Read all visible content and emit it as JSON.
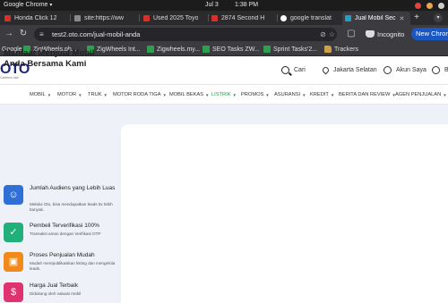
{
  "os_bar": {
    "app_name": "Google Chrome",
    "date": "Jul 3",
    "time": "1:38 PM"
  },
  "tabs": [
    {
      "label": "Honda Click 12",
      "favicon_color": "#d93025",
      "active": false
    },
    {
      "label": "site:https://ww",
      "favicon_color": "#8a8a8a",
      "active": false
    },
    {
      "label": "Used 2025 Toyo",
      "favicon_color": "#d93025",
      "active": false
    },
    {
      "label": "2874 Second H",
      "favicon_color": "#d93025",
      "active": false
    },
    {
      "label": "google translat",
      "favicon_color": "#ffffff",
      "active": false
    },
    {
      "label": "Jual Mobil Sec",
      "favicon_color": "#1fa0c9",
      "active": true
    }
  ],
  "toolbar": {
    "url": "test2.oto.com/jual-mobil-anda",
    "incognito_label": "Incognito",
    "new_chrome_label": "New Chrom"
  },
  "bookmarks": [
    {
      "label": "Google",
      "icon": "google-icon"
    },
    {
      "label": "ZigWheels.ph...",
      "icon": "green-square-icon"
    },
    {
      "label": "ZigWheels Int...",
      "icon": "green-square-icon"
    },
    {
      "label": "Zigwheels.my...",
      "icon": "green-square-icon"
    },
    {
      "label": "SEO Tasks ZW...",
      "icon": "green-square-icon"
    },
    {
      "label": "Sprint Tasks'2...",
      "icon": "green-square-icon"
    },
    {
      "label": "Trackers",
      "icon": "folder-icon"
    }
  ],
  "site_header": {
    "logo": "OTO",
    "logo_tagline": "Carilemu kita",
    "search_label": "Cari",
    "location_label": "Jakarta Selatan",
    "account_label": "Akun Saya",
    "language_label": "B"
  },
  "nav": [
    {
      "label": "MOBIL",
      "highlight": false
    },
    {
      "label": "MOTOR",
      "highlight": false
    },
    {
      "label": "TRUK",
      "highlight": false
    },
    {
      "label": "MOTOR RODA TIGA",
      "highlight": false
    },
    {
      "label": "MOBIL BEKAS",
      "highlight": false
    },
    {
      "label": "LISTRIK",
      "highlight": true
    },
    {
      "label": "PROMOS",
      "highlight": false
    },
    {
      "label": "ASURANSI",
      "highlight": false
    },
    {
      "label": "KREDIT",
      "highlight": false
    },
    {
      "label": "BERITA DAN REVIEW",
      "highlight": false
    },
    {
      "label": "AGEN PENJUALAN",
      "highlight": false
    }
  ],
  "benefits": {
    "title": "Manfaat Menjual Mobil Anda Bersama Kami",
    "items": [
      {
        "title": "Jumlah Audiens yang Lebih Luas",
        "desc": "Melalui Oto, bisa mendapatkan leads 5x lebih banyak.",
        "icon": "users-icon",
        "color": "#2f6fd6"
      },
      {
        "title": "Pembeli Terverifikasi 100%",
        "desc": "Transaksi aman dengan Verifikasi OTP",
        "icon": "verified-icon",
        "color": "#22b07a"
      },
      {
        "title": "Proses Penjualan Mudah",
        "desc": "Mudah mempublikasikan listing dan mengelola leads.",
        "icon": "box-icon",
        "color": "#f08a1a"
      },
      {
        "title": "Harga Jual Terbaik",
        "desc": "Didukung oleh valuasi mobil",
        "icon": "price-tag-icon",
        "color": "#e0326e"
      }
    ]
  }
}
